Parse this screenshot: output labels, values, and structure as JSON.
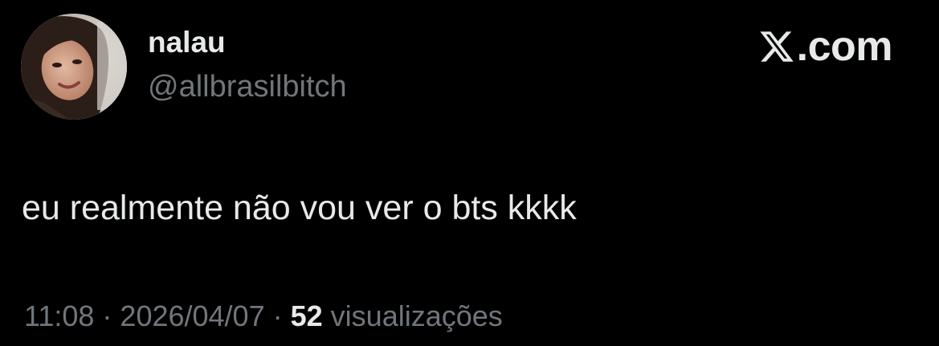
{
  "author": {
    "display_name": "nalau",
    "handle": "@allbrasilbitch"
  },
  "brand": {
    "text": ".com",
    "icon": "x-logo-icon"
  },
  "tweet": {
    "text": "eu realmente não vou ver o bts kkkk"
  },
  "meta": {
    "time": "11:08",
    "separator": " · ",
    "date": "2026/04/07",
    "views_count": "52",
    "views_label": "visualizações"
  },
  "colors": {
    "background": "#000000",
    "primary_text": "#e7e9ea",
    "secondary_text": "#71767b"
  }
}
